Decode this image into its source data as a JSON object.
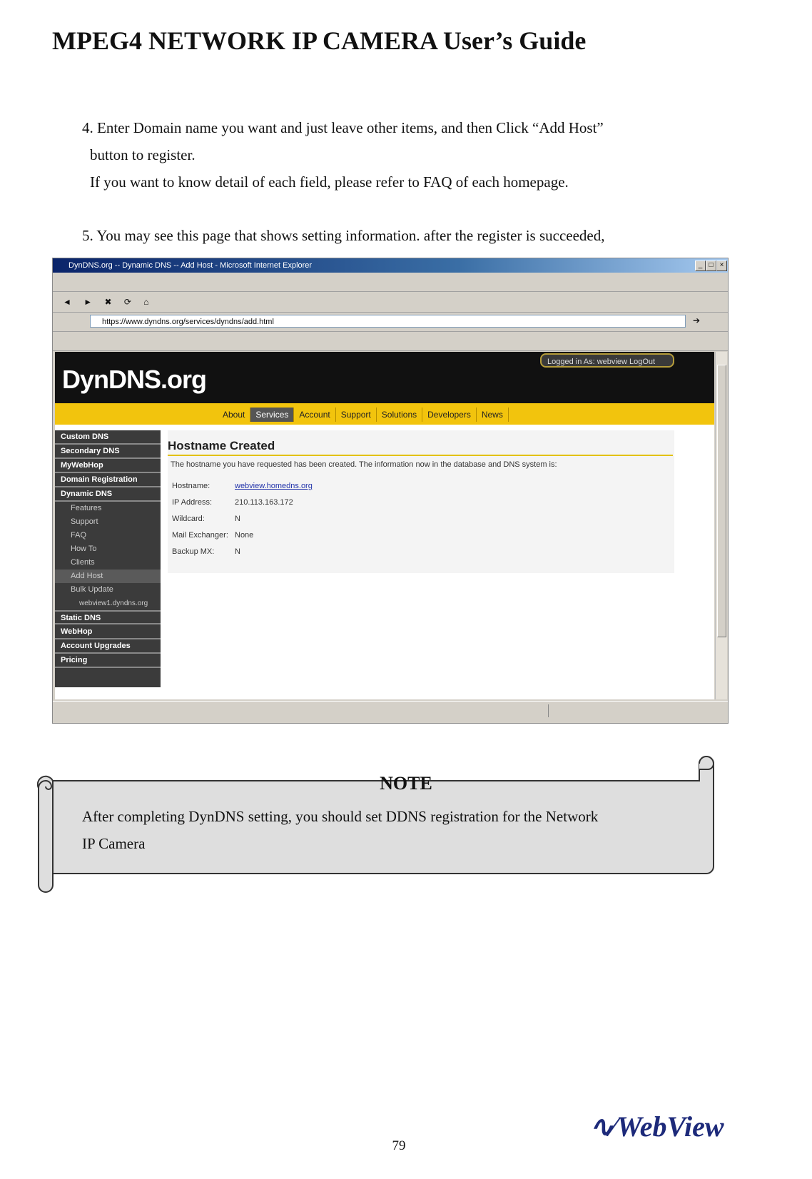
{
  "header": {
    "title": "MPEG4 NETWORK IP CAMERA User’s Guide"
  },
  "step4": {
    "line1": "4. Enter Domain name you want and just leave other items, and then Click “Add Host”",
    "line2": "button to register.",
    "line3": "If you want to know detail of each field, please refer to FAQ of each homepage."
  },
  "step5": {
    "text": "5. You may see this page that shows setting information. after the register is succeeded,"
  },
  "screenshot": {
    "window_title": "DynDNS.org -- Dynamic DNS -- Add Host - Microsoft Internet Explorer",
    "address_url": "https://www.dyndns.org/services/dyndns/add.html",
    "logo": {
      "main": "DynDNS",
      "suffix": ".org"
    },
    "logged_in": "Logged in As: webview LogOut",
    "nav_tabs": [
      "About",
      "Services",
      "Account",
      "Support",
      "Solutions",
      "Developers",
      "News"
    ],
    "left_nav": {
      "custom_dns": "Custom DNS",
      "secondary_dns": "Secondary DNS",
      "mywebhop": "MyWebHop",
      "domain_registration": "Domain Registration",
      "dynamic_dns": "Dynamic DNS",
      "features": "Features",
      "support": "Support",
      "faq": "FAQ",
      "howto": "How To",
      "clients": "Clients",
      "add_host": "Add Host",
      "bulk_update": "Bulk Update",
      "host_entry": "webview1.dyndns.org",
      "static_dns": "Static DNS",
      "webhop": "WebHop",
      "account_upgrades": "Account Upgrades",
      "pricing": "Pricing"
    },
    "content": {
      "heading": "Hostname Created",
      "message": "The hostname you have requested has been created. The information now in the database and DNS system is:",
      "fields": [
        {
          "label": "Hostname:",
          "value": "webview.homedns.org"
        },
        {
          "label": "IP Address:",
          "value": "210.113.163.172"
        },
        {
          "label": "Wildcard:",
          "value": "N"
        },
        {
          "label": "Mail Exchanger:",
          "value": "None"
        },
        {
          "label": "Backup MX:",
          "value": "N"
        }
      ]
    }
  },
  "note": {
    "title": "NOTE",
    "line1": "After completing DynDNS setting, you should set DDNS registration for the Network",
    "line2": "IP Camera"
  },
  "footer": {
    "page_number": "79",
    "brand": "WebView"
  }
}
